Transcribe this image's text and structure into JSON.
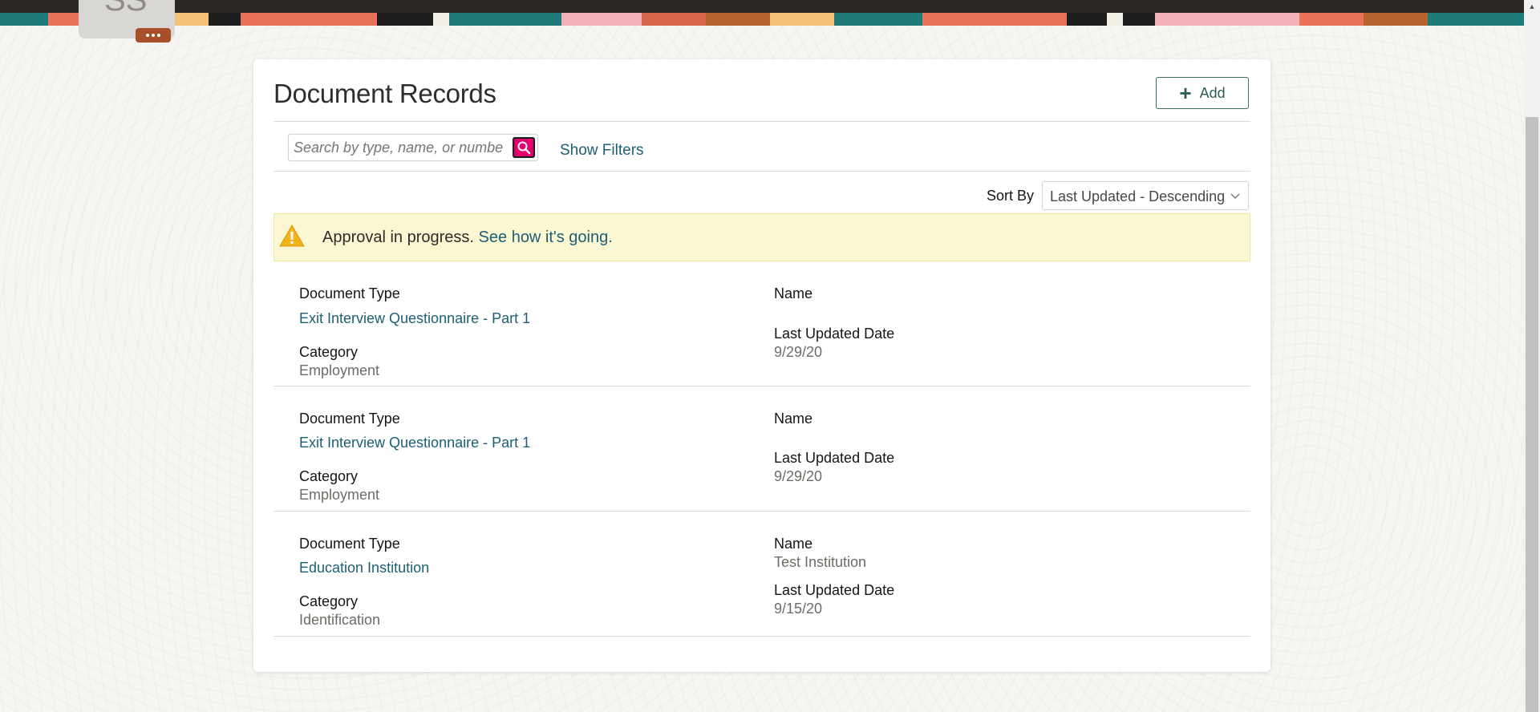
{
  "header": {
    "avatar_initials": "SS",
    "more_badge": "more-options-icon"
  },
  "page": {
    "title": "Document Records",
    "add_label": "Add"
  },
  "search": {
    "placeholder": "Search by type, name, or numbe",
    "value": "",
    "show_filters_label": "Show Filters"
  },
  "sort": {
    "label": "Sort By",
    "selected": "Last Updated - Descending"
  },
  "alert": {
    "message": "Approval in progress.",
    "link": "See how it's going."
  },
  "labels": {
    "document_type": "Document Type",
    "category": "Category",
    "name": "Name",
    "last_updated": "Last Updated Date"
  },
  "records": [
    {
      "document_type": "Exit Interview Questionnaire - Part 1",
      "category": "Employment",
      "name": "",
      "last_updated": "9/29/20"
    },
    {
      "document_type": "Exit Interview Questionnaire - Part 1",
      "category": "Employment",
      "name": "",
      "last_updated": "9/29/20"
    },
    {
      "document_type": "Education Institution",
      "category": "Identification",
      "name": "Test Institution",
      "last_updated": "9/15/20"
    }
  ],
  "colors": {
    "link": "#1c5e75",
    "alert_bg": "#fbf7d3",
    "warning": "#f1b41c",
    "search_button": "#e4006f",
    "badge": "#a8502a"
  }
}
